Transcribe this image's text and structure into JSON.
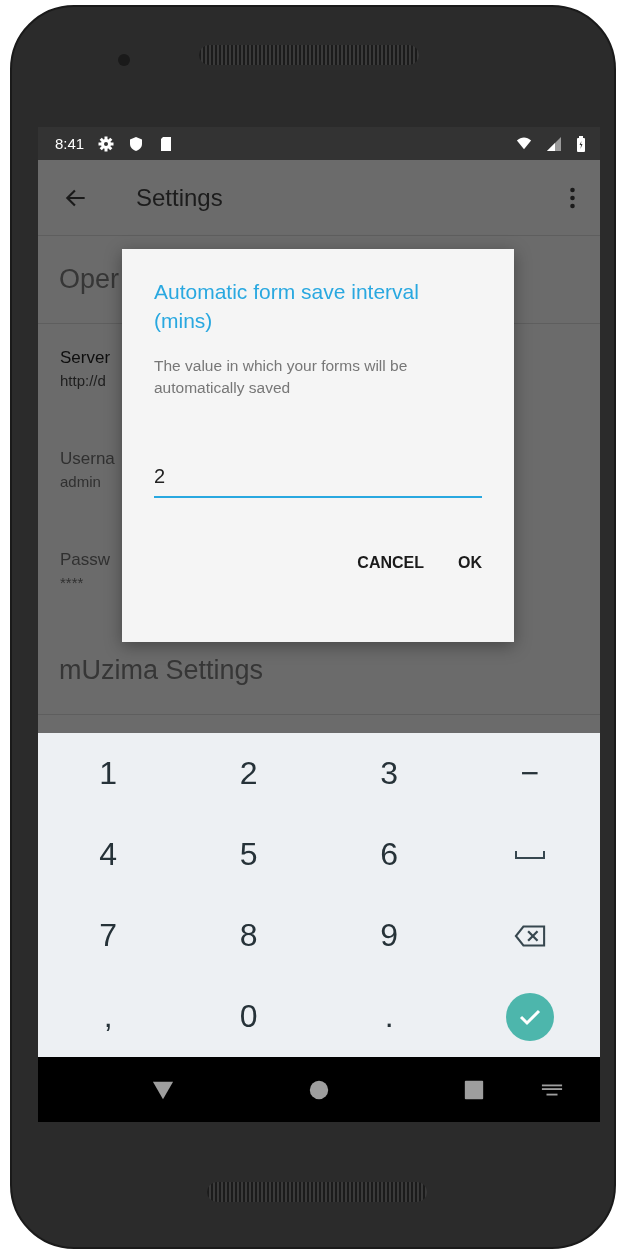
{
  "status_bar": {
    "time": "8:41"
  },
  "app_bar": {
    "title": "Settings"
  },
  "background": {
    "section_title": "Oper",
    "items": [
      {
        "title": "Server",
        "value": "http://d",
        "disabled": false
      },
      {
        "title": "Userna",
        "value": "admin",
        "disabled": true
      },
      {
        "title": "Passw",
        "value": "****",
        "disabled": true
      }
    ],
    "section_title_2": "mUzima Settings"
  },
  "dialog": {
    "title": "Automatic form save interval (mins)",
    "message": "The value in which your forms will be automatically saved",
    "input": {
      "value": "2"
    },
    "buttons": [
      "CANCEL",
      "OK"
    ]
  },
  "keyboard": {
    "rows": [
      [
        {
          "kind": "char",
          "label": "1"
        },
        {
          "kind": "char",
          "label": "2"
        },
        {
          "kind": "char",
          "label": "3"
        },
        {
          "kind": "char",
          "label": "−"
        }
      ],
      [
        {
          "kind": "char",
          "label": "4"
        },
        {
          "kind": "char",
          "label": "5"
        },
        {
          "kind": "char",
          "label": "6"
        },
        {
          "kind": "space"
        }
      ],
      [
        {
          "kind": "char",
          "label": "7"
        },
        {
          "kind": "char",
          "label": "8"
        },
        {
          "kind": "char",
          "label": "9"
        },
        {
          "kind": "backspace"
        }
      ],
      [
        {
          "kind": "char",
          "label": ","
        },
        {
          "kind": "char",
          "label": "0"
        },
        {
          "kind": "char",
          "label": "."
        },
        {
          "kind": "done"
        }
      ]
    ]
  }
}
